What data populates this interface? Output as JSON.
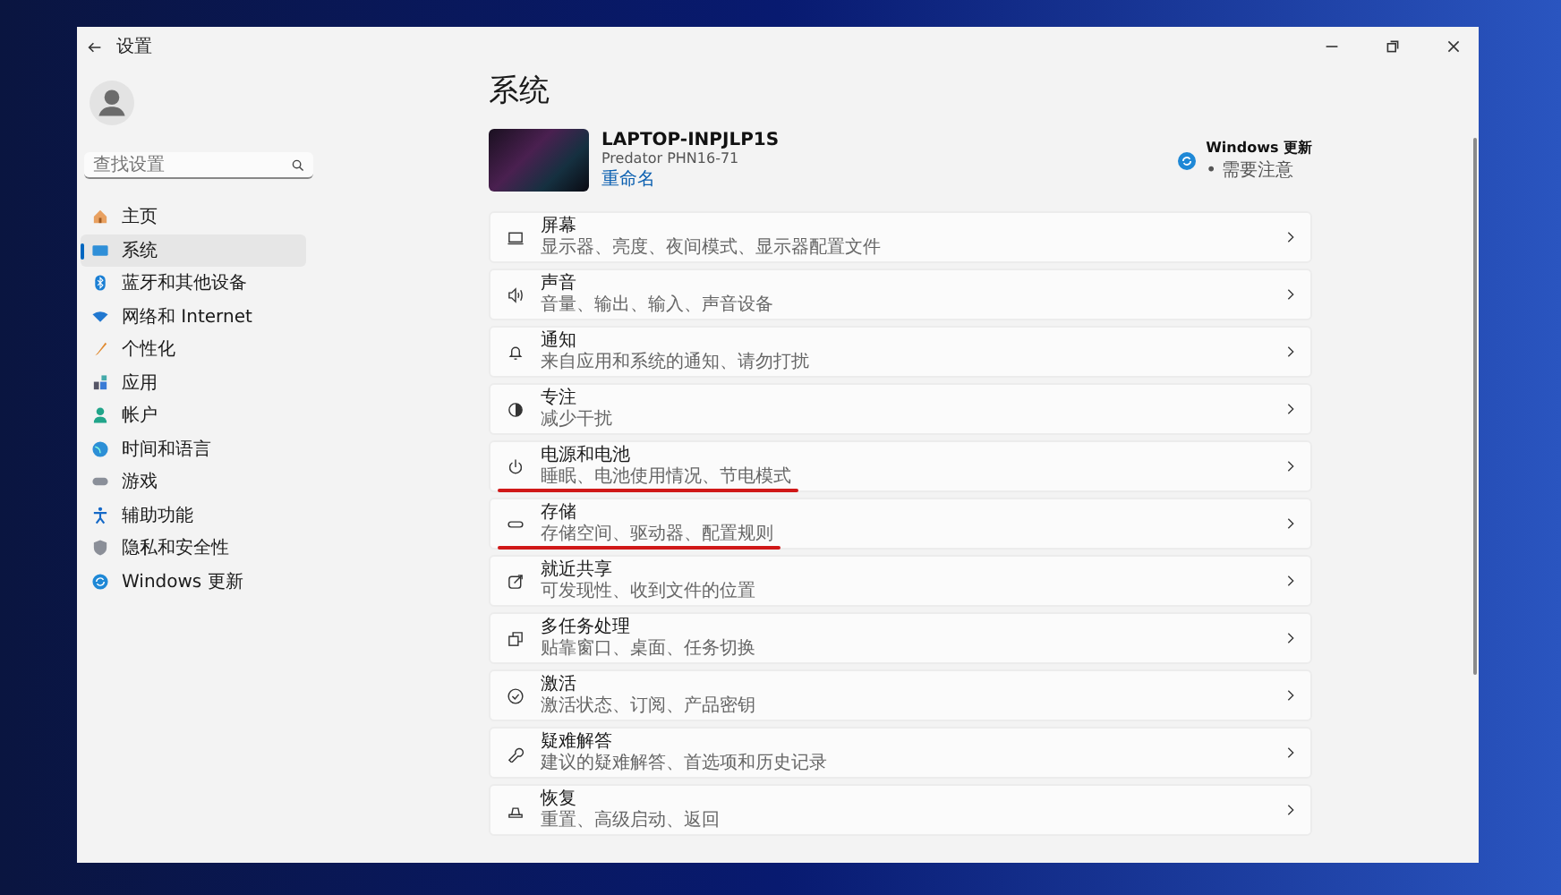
{
  "window": {
    "title": "设置"
  },
  "sidebar": {
    "search": {
      "placeholder": "查找设置"
    },
    "items": [
      {
        "label": "主页",
        "selected": false
      },
      {
        "label": "系统",
        "selected": true
      },
      {
        "label": "蓝牙和其他设备",
        "selected": false
      },
      {
        "label": "网络和 Internet",
        "selected": false
      },
      {
        "label": "个性化",
        "selected": false
      },
      {
        "label": "应用",
        "selected": false
      },
      {
        "label": "帐户",
        "selected": false
      },
      {
        "label": "时间和语言",
        "selected": false
      },
      {
        "label": "游戏",
        "selected": false
      },
      {
        "label": "辅助功能",
        "selected": false
      },
      {
        "label": "隐私和安全性",
        "selected": false
      },
      {
        "label": "Windows 更新",
        "selected": false
      }
    ]
  },
  "page": {
    "title": "系统",
    "device": {
      "name": "LAPTOP-INPJLP1S",
      "model": "Predator PHN16-71",
      "rename_link": "重命名"
    },
    "update": {
      "title": "Windows 更新",
      "status": "• 需要注意"
    },
    "cards": [
      {
        "title": "屏幕",
        "subtitle": "显示器、亮度、夜间模式、显示器配置文件",
        "underlined": false
      },
      {
        "title": "声音",
        "subtitle": "音量、输出、输入、声音设备",
        "underlined": false
      },
      {
        "title": "通知",
        "subtitle": "来自应用和系统的通知、请勿打扰",
        "underlined": false
      },
      {
        "title": "专注",
        "subtitle": "减少干扰",
        "underlined": false
      },
      {
        "title": "电源和电池",
        "subtitle": "睡眠、电池使用情况、节电模式",
        "underlined": true
      },
      {
        "title": "存储",
        "subtitle": "存储空间、驱动器、配置规则",
        "underlined": true
      },
      {
        "title": "就近共享",
        "subtitle": "可发现性、收到文件的位置",
        "underlined": false
      },
      {
        "title": "多任务处理",
        "subtitle": "贴靠窗口、桌面、任务切换",
        "underlined": false
      },
      {
        "title": "激活",
        "subtitle": "激活状态、订阅、产品密钥",
        "underlined": false
      },
      {
        "title": "疑难解答",
        "subtitle": "建议的疑难解答、首选项和历史记录",
        "underlined": false
      },
      {
        "title": "恢复",
        "subtitle": "重置、高级启动、返回",
        "underlined": false
      }
    ]
  }
}
